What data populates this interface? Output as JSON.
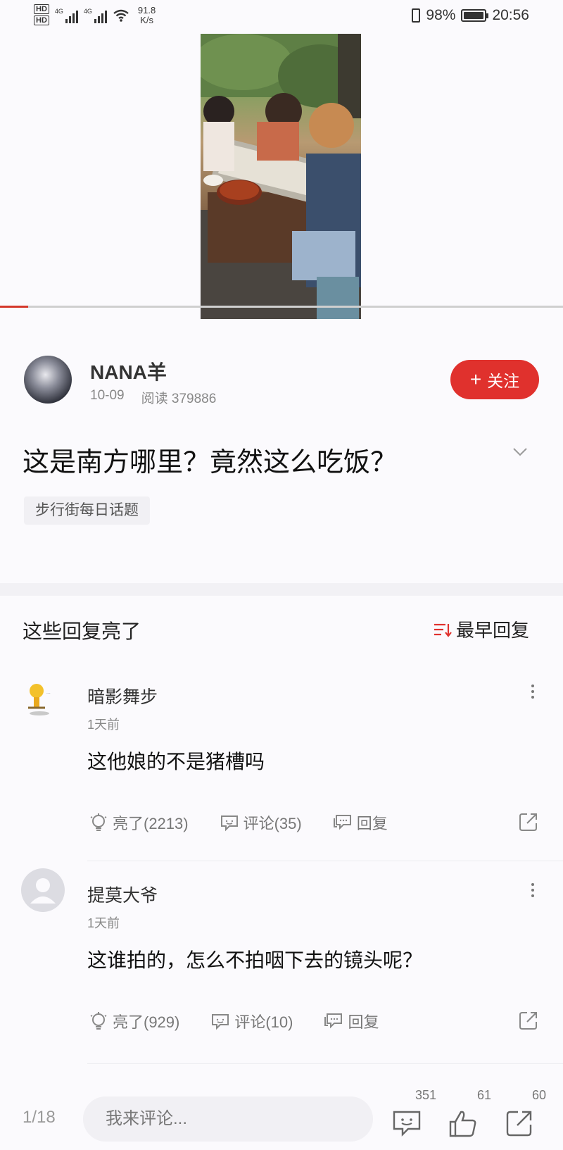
{
  "status_bar": {
    "hd1": "HD",
    "hd2": "HD",
    "sig1": "4G",
    "sig2": "4G",
    "net_speed_value": "91.8",
    "net_speed_unit": "K/s",
    "battery": "98%",
    "time": "20:56",
    "battery_level": 0.98
  },
  "video": {
    "progress": 0.05,
    "progress_color": "#d4382b"
  },
  "author": {
    "name": "NANA羊",
    "date": "10-09",
    "reads": "阅读 379886",
    "follow_label": "关注",
    "follow_plus": "+"
  },
  "post": {
    "title": "这是南方哪里？竟然这么吃饭？",
    "topic": "步行街每日话题"
  },
  "replies": {
    "heading": "这些回复亮了",
    "sort_label": "最早回复",
    "items": [
      {
        "name": "暗影舞步",
        "time": "1天前",
        "text": "这他娘的不是猪槽吗",
        "light": "亮了(2213)",
        "comment": "评论(35)",
        "reply": "回复"
      },
      {
        "name": "提莫大爷",
        "time": "1天前",
        "text": "这谁拍的，怎么不拍咽下去的镜头呢？",
        "light": "亮了(929)",
        "comment": "评论(10)",
        "reply": "回复"
      }
    ]
  },
  "bottom_bar": {
    "page": "1/18",
    "input_placeholder": "我来评论...",
    "comment_count": "351",
    "like_count": "61",
    "share_count": "60"
  },
  "colors": {
    "accent": "#e0312d",
    "background": "#fbfafd"
  },
  "icons": [
    "wifi-icon",
    "vibrate-icon",
    "battery-icon",
    "chevron-down-icon",
    "sort-icon",
    "lightbulb-icon",
    "comment-icon",
    "reply-icon",
    "share-icon",
    "more-icon",
    "like-icon"
  ]
}
